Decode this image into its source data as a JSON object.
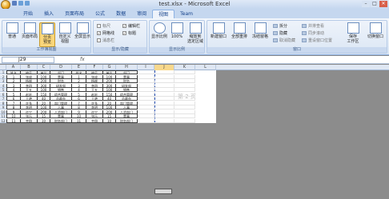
{
  "window": {
    "title": "test.xlsx - Microsoft Excel",
    "minimize": "–",
    "maximize": "□",
    "close": "✕"
  },
  "tabs": [
    "开始",
    "插入",
    "页面布局",
    "公式",
    "数据",
    "审阅",
    "视图",
    "Team"
  ],
  "active_tab": "视图",
  "ribbon": {
    "workbook_views": {
      "label": "工作簿视图",
      "normal": "普通",
      "page_layout": "页面布局",
      "page_break": "分页\n预览",
      "custom_views": "自定义\n视图",
      "full_screen": "全屏显示"
    },
    "show_hide": {
      "label": "显示/隐藏",
      "ruler": "标尺",
      "gridlines": "网格线",
      "message_bar": "消息栏",
      "formula_bar": "编辑栏",
      "headings": "标题",
      "check": "✓"
    },
    "zoom": {
      "label": "显示比例",
      "zoom": "显示比例",
      "hundred": "100%",
      "zoom_selection": "缩放到\n选定区域"
    },
    "window": {
      "label": "窗口",
      "new_window": "新建窗口",
      "arrange_all": "全部重排",
      "freeze_panes": "冻结窗格",
      "split": "拆分",
      "hide": "隐藏",
      "unhide": "取消隐藏",
      "view_side": "并排查看",
      "sync_scroll": "同步滚动",
      "reset_position": "重设窗口位置",
      "save_workspace": "保存\n工作区",
      "switch_windows": "切换窗口"
    }
  },
  "formula_bar": {
    "name_box": "J29",
    "fx": "fx"
  },
  "columns": [
    "A",
    "B",
    "C",
    "D",
    "E",
    "F",
    "G",
    "H",
    "I",
    "J",
    "K",
    "L"
  ],
  "rows": [
    [
      "姓名",
      "编号",
      "单位",
      "部门",
      "姓名",
      "编号",
      "单位",
      "部门"
    ],
    [
      "1",
      "张成",
      "100",
      "董事",
      "1",
      "张成",
      "100",
      "董事"
    ],
    [
      "2",
      "杨柳",
      "200",
      "财务",
      "2",
      "杨柳",
      "200",
      "财务"
    ],
    [
      "3",
      "李四",
      "300",
      "研发部",
      "3",
      "李四",
      "300",
      "研发部"
    ],
    [
      "4",
      "王五",
      "100",
      "销售",
      "4",
      "王五",
      "100",
      "销售"
    ],
    [
      "5",
      "赵宏",
      "150",
      "综合管理",
      "5",
      "赵宏",
      "150",
      "综合管理"
    ],
    [
      "6",
      "王艳",
      "40",
      "总裁办",
      "6",
      "王艳",
      "40",
      "总裁办"
    ],
    [
      "7",
      "许多",
      "20",
      "部门管理",
      "7",
      "许多",
      "20",
      "部门管理"
    ],
    [
      "8",
      "李明",
      "100",
      "人事",
      "8",
      "李明",
      "100",
      "人事"
    ],
    [
      "9",
      "孙宁",
      "200",
      "人资部门",
      "9",
      "孙宁",
      "200",
      "人资部门"
    ],
    [
      "10",
      "张乐",
      "15",
      "董事",
      "10",
      "张乐",
      "15",
      "董事"
    ],
    [
      "11",
      "齐翔",
      "10",
      "财务部门",
      "11",
      "齐翔",
      "10",
      "财务部门"
    ]
  ],
  "page_label": "第 2 页",
  "colors": {
    "accent": "#15428b",
    "ribbon_bg": "#dce7f5",
    "page_break_line": "#2b54b8",
    "grey_area": "#8c8c8c"
  }
}
